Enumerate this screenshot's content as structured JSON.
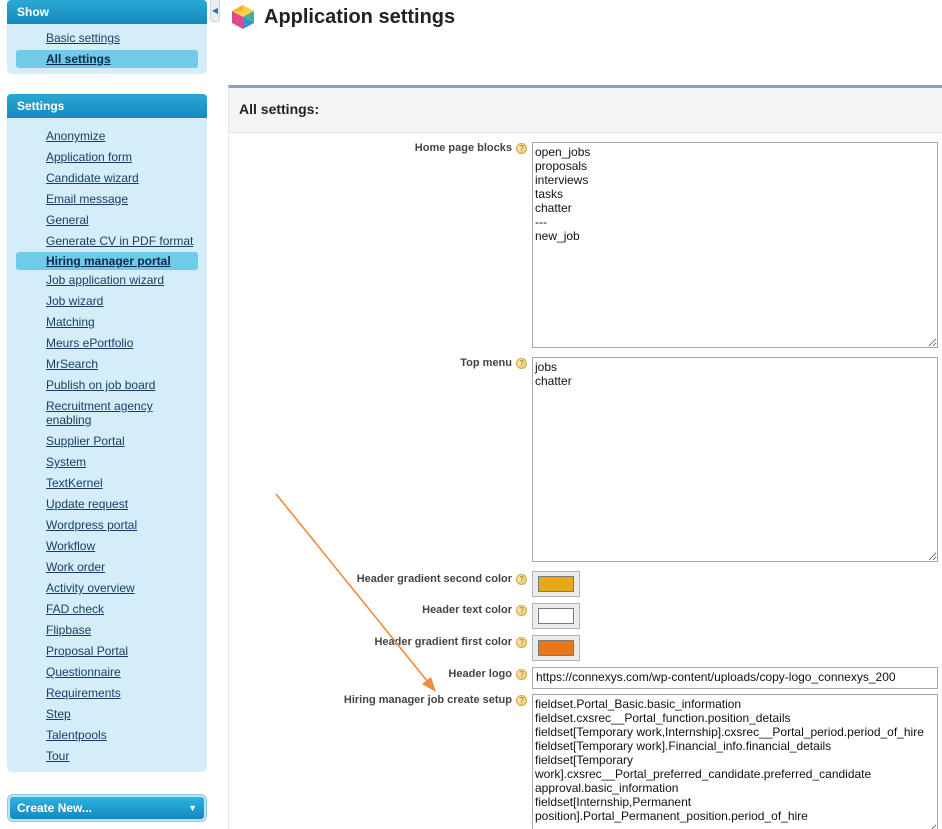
{
  "sidebar": {
    "show_panel": {
      "title": "Show",
      "items": [
        {
          "label": "Basic settings"
        },
        {
          "label": "All settings"
        }
      ]
    },
    "settings_panel": {
      "title": "Settings",
      "items": [
        {
          "label": "Anonymize"
        },
        {
          "label": "Application form"
        },
        {
          "label": "Candidate wizard"
        },
        {
          "label": "Email message"
        },
        {
          "label": "General"
        },
        {
          "label": "Generate CV in PDF format"
        },
        {
          "label": "Hiring manager portal"
        },
        {
          "label": "Job application wizard"
        },
        {
          "label": "Job wizard"
        },
        {
          "label": "Matching"
        },
        {
          "label": "Meurs ePortfolio"
        },
        {
          "label": "MrSearch"
        },
        {
          "label": "Publish on job board"
        },
        {
          "label": "Recruitment agency\nenabling"
        },
        {
          "label": "Supplier Portal"
        },
        {
          "label": "System"
        },
        {
          "label": "TextKernel"
        },
        {
          "label": "Update request"
        },
        {
          "label": "Wordpress portal"
        },
        {
          "label": "Workflow"
        },
        {
          "label": "Work order"
        },
        {
          "label": "Activity overview"
        },
        {
          "label": "FAD check"
        },
        {
          "label": "Flipbase"
        },
        {
          "label": "Proposal Portal"
        },
        {
          "label": "Questionnaire"
        },
        {
          "label": "Requirements"
        },
        {
          "label": "Step"
        },
        {
          "label": "Talentpools"
        },
        {
          "label": "Tour"
        }
      ]
    },
    "create_new": {
      "label": "Create New...",
      "caret": "▼"
    },
    "collapse_glyph": "◀"
  },
  "header": {
    "title": "Application settings"
  },
  "main": {
    "section_title": "All settings:",
    "fields": {
      "home_page_blocks": {
        "label": "Home page blocks",
        "value": "open_jobs\nproposals\ninterviews\ntasks\nchatter\n---\nnew_job"
      },
      "top_menu": {
        "label": "Top menu",
        "value": "jobs\nchatter"
      },
      "header_gradient_second_color": {
        "label": "Header gradient second color",
        "color": "#e6a817"
      },
      "header_text_color": {
        "label": "Header text color",
        "color": "#ffffff"
      },
      "header_gradient_first_color": {
        "label": "Header gradient first color",
        "color": "#e8781a"
      },
      "header_logo": {
        "label": "Header logo",
        "value": "https://connexys.com/wp-content/uploads/copy-logo_connexys_200"
      },
      "hiring_manager_job_create_setup": {
        "label": "Hiring manager job create setup",
        "value": "fieldset.Portal_Basic.basic_information\nfieldset.cxsrec__Portal_function.position_details\nfieldset[Temporary work,Internship].cxsrec__Portal_period.period_of_hire\nfieldset[Temporary work].Financial_info.financial_details\nfieldset[Temporary\nwork].cxsrec__Portal_preferred_candidate.preferred_candidate\napproval.basic_information\nfieldset[Internship,Permanent\nposition].Portal_Permanent_position.period_of_hire"
      }
    },
    "help_glyph": "?"
  },
  "colors": {
    "accent": "#1a9fd4",
    "annotation_arrow": "#f08a3c"
  }
}
